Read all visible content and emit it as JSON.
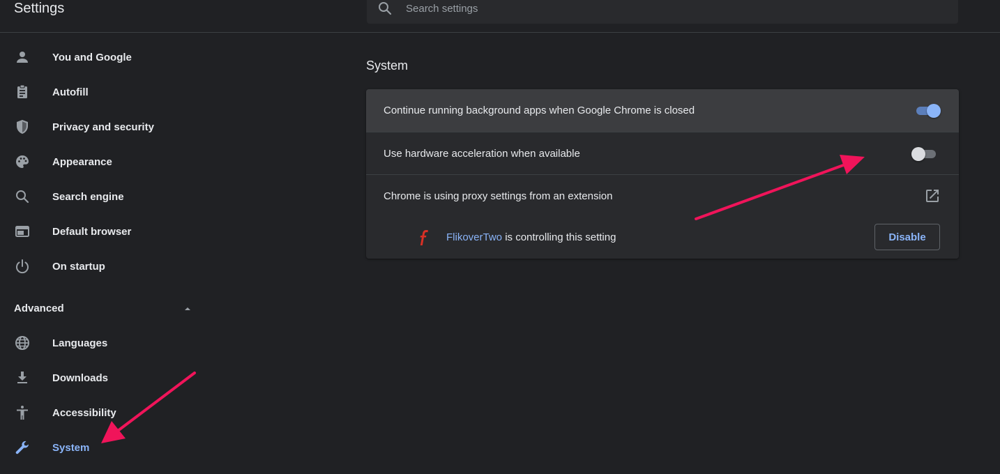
{
  "app": {
    "title": "Settings"
  },
  "search": {
    "placeholder": "Search settings",
    "icon": "search-icon"
  },
  "sidebar": {
    "items": [
      {
        "label": "You and Google",
        "icon": "person-icon"
      },
      {
        "label": "Autofill",
        "icon": "clipboard-icon"
      },
      {
        "label": "Privacy and security",
        "icon": "shield-icon"
      },
      {
        "label": "Appearance",
        "icon": "palette-icon"
      },
      {
        "label": "Search engine",
        "icon": "search-icon"
      },
      {
        "label": "Default browser",
        "icon": "browser-window-icon"
      },
      {
        "label": "On startup",
        "icon": "power-icon"
      }
    ],
    "advanced": {
      "label": "Advanced",
      "expanded": true
    },
    "advanced_items": [
      {
        "label": "Languages",
        "icon": "globe-icon"
      },
      {
        "label": "Downloads",
        "icon": "download-icon"
      },
      {
        "label": "Accessibility",
        "icon": "accessibility-icon"
      },
      {
        "label": "System",
        "icon": "wrench-icon",
        "active": true
      }
    ]
  },
  "main": {
    "section_title": "System",
    "rows": [
      {
        "label": "Continue running background apps when Google Chrome is closed",
        "toggle": true
      },
      {
        "label": "Use hardware acceleration when available",
        "toggle": false
      },
      {
        "label": "Chrome is using proxy settings from an extension",
        "icon": "open-in-new-icon"
      }
    ],
    "extension": {
      "name": "FlikoverTwo",
      "suffix": " is controlling this setting",
      "button": "Disable"
    }
  },
  "colors": {
    "background": "#202124",
    "card": "#292a2d",
    "accent": "#8ab4f8",
    "annotation_arrow": "#f0145a"
  }
}
